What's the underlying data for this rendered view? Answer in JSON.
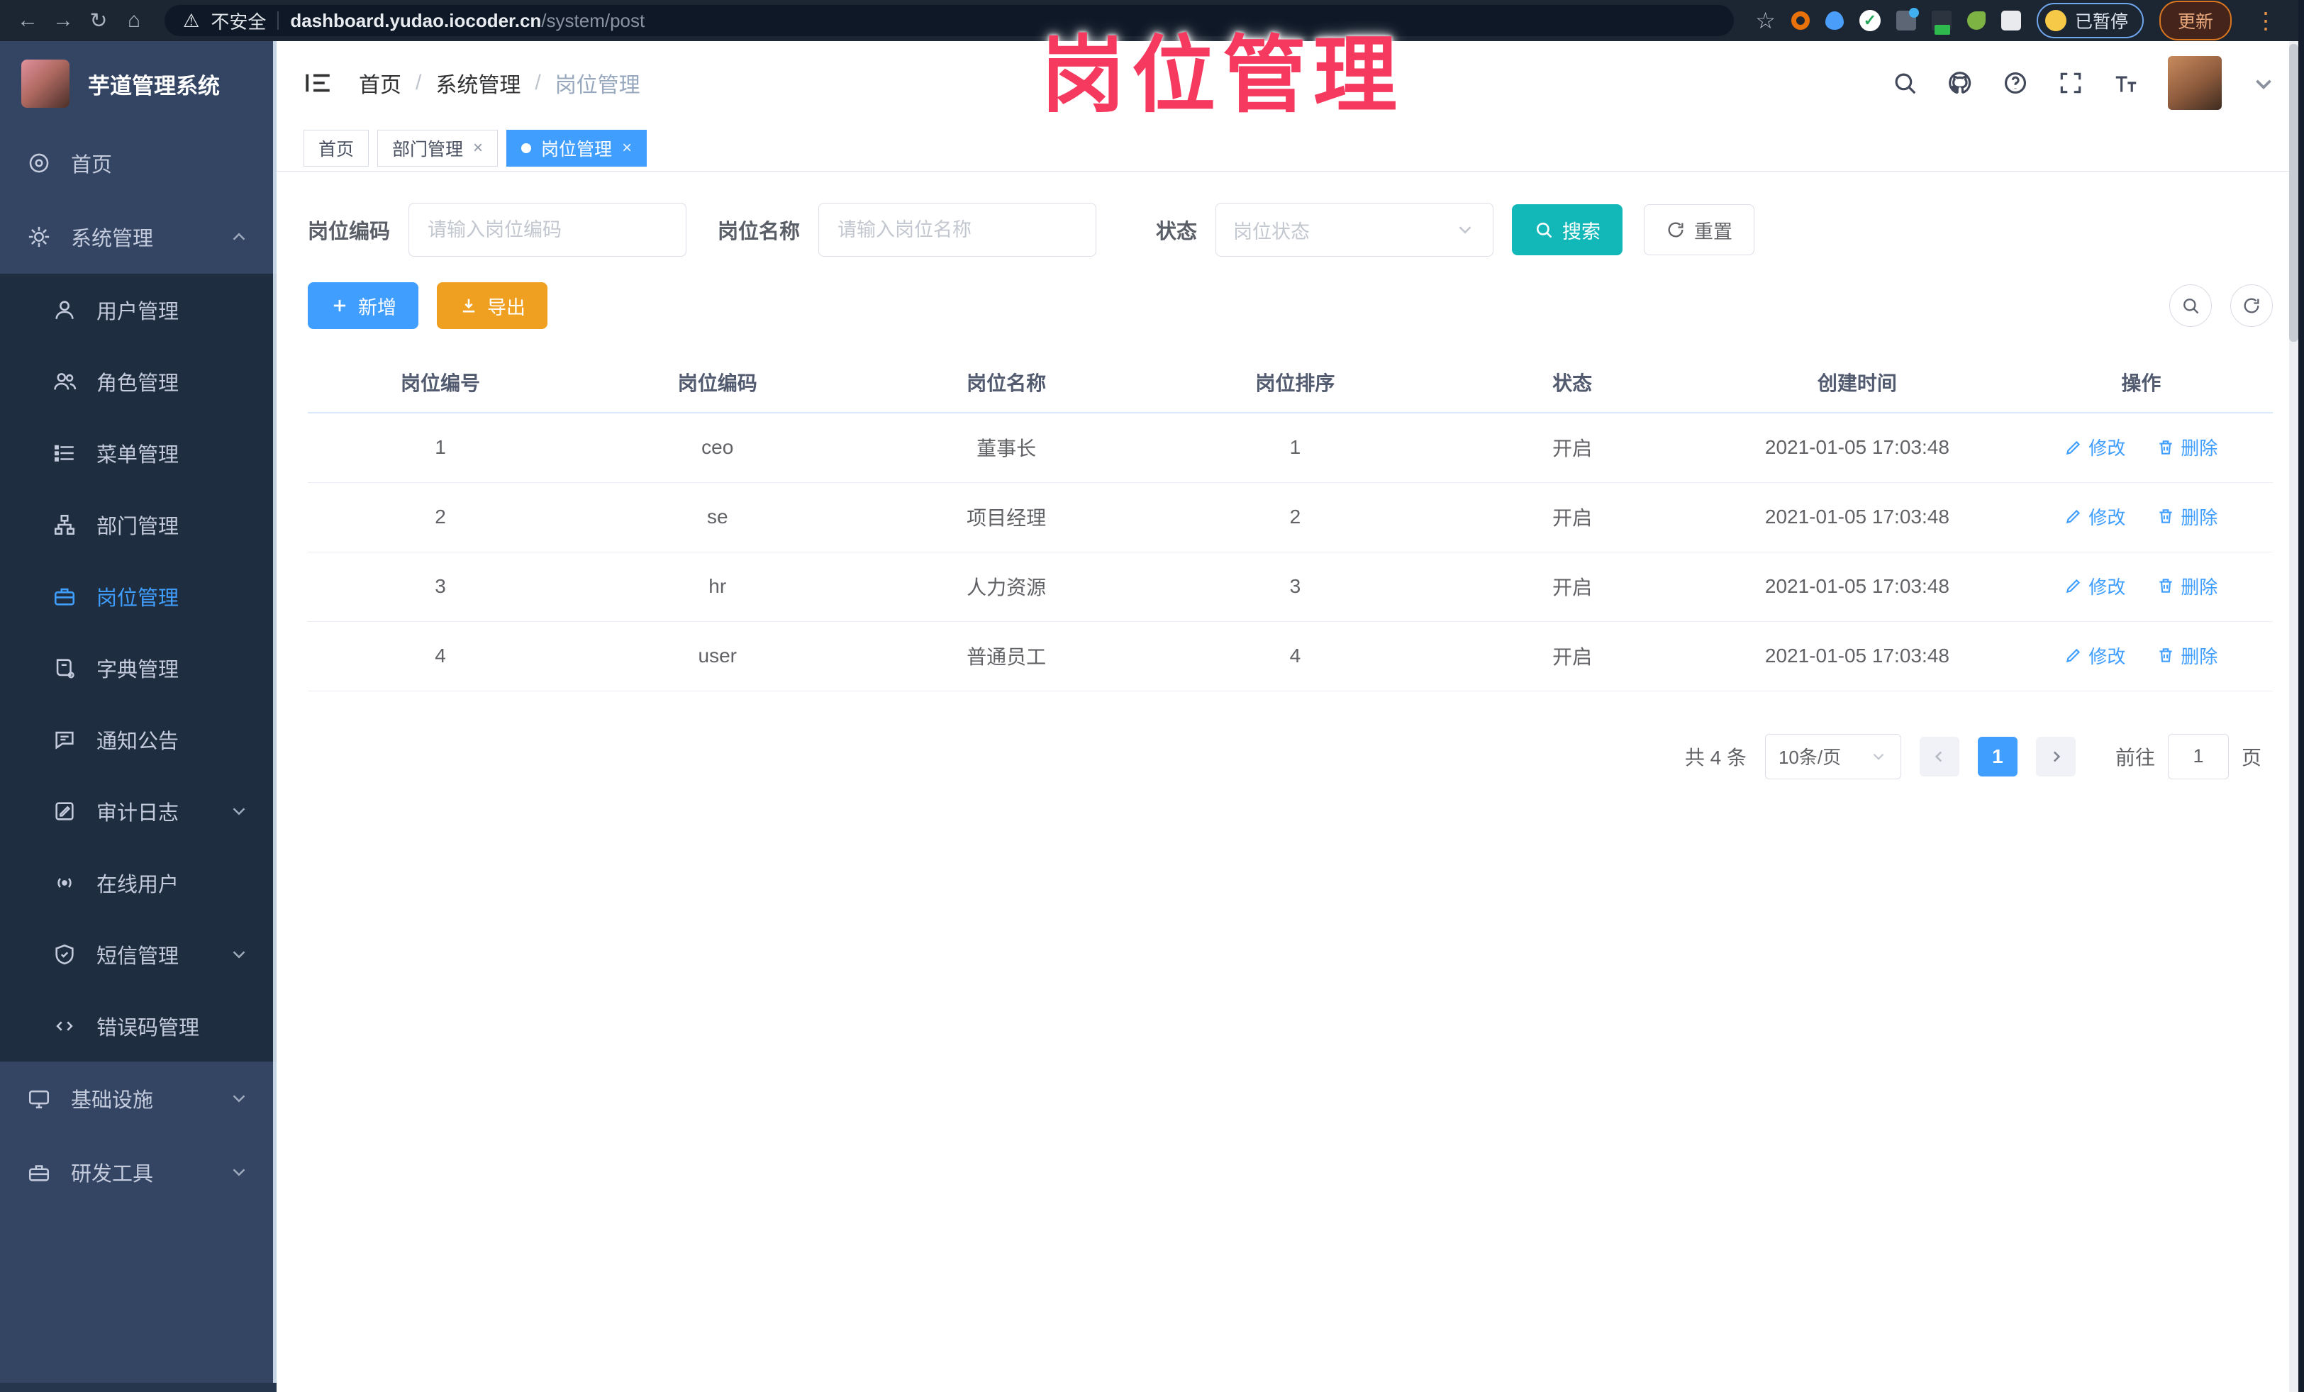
{
  "overlay_title": "岗位管理",
  "browser": {
    "security_label": "不安全",
    "url_host": "dashboard.yudao.iocoder.cn",
    "url_path": "/system/post",
    "paused_badge": "已暂停",
    "update_label": "更新"
  },
  "sidebar": {
    "app_title": "芋道管理系统",
    "home_label": "首页",
    "system_label": "系统管理",
    "system_children": [
      "用户管理",
      "角色管理",
      "菜单管理",
      "部门管理",
      "岗位管理",
      "字典管理",
      "通知公告",
      "审计日志",
      "在线用户",
      "短信管理",
      "错误码管理"
    ],
    "infra_label": "基础设施",
    "devtools_label": "研发工具"
  },
  "header": {
    "breadcrumb": [
      "首页",
      "系统管理",
      "岗位管理"
    ]
  },
  "tabs": [
    {
      "label": "首页"
    },
    {
      "label": "部门管理"
    },
    {
      "label": "岗位管理"
    }
  ],
  "filters": {
    "code_label": "岗位编码",
    "code_placeholder": "请输入岗位编码",
    "name_label": "岗位名称",
    "name_placeholder": "请输入岗位名称",
    "status_label": "状态",
    "status_placeholder": "岗位状态",
    "search_label": "搜索",
    "reset_label": "重置"
  },
  "toolbar": {
    "add_label": "新增",
    "export_label": "导出"
  },
  "table": {
    "columns": [
      "岗位编号",
      "岗位编码",
      "岗位名称",
      "岗位排序",
      "状态",
      "创建时间",
      "操作"
    ],
    "edit_label": "修改",
    "delete_label": "删除",
    "rows": [
      {
        "id": "1",
        "code": "ceo",
        "name": "董事长",
        "sort": "1",
        "status": "开启",
        "created": "2021-01-05 17:03:48"
      },
      {
        "id": "2",
        "code": "se",
        "name": "项目经理",
        "sort": "2",
        "status": "开启",
        "created": "2021-01-05 17:03:48"
      },
      {
        "id": "3",
        "code": "hr",
        "name": "人力资源",
        "sort": "3",
        "status": "开启",
        "created": "2021-01-05 17:03:48"
      },
      {
        "id": "4",
        "code": "user",
        "name": "普通员工",
        "sort": "4",
        "status": "开启",
        "created": "2021-01-05 17:03:48"
      }
    ]
  },
  "pagination": {
    "total_label": "共 4 条",
    "page_size_label": "10条/页",
    "current_page": "1",
    "goto_label": "前往",
    "goto_value": "1",
    "page_unit_label": "页"
  },
  "colors": {
    "accent_blue": "#409EFF",
    "search_teal": "#12b7b7",
    "export_orange": "#f0a020",
    "watermark_pink": "#f5395f",
    "sidebar_bg": "#344563",
    "submenu_bg": "#1e2d3f"
  }
}
